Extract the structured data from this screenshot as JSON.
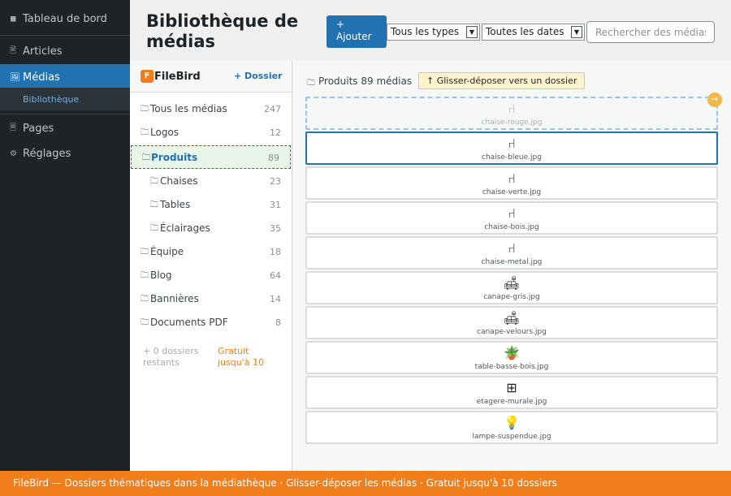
{
  "admin_menu": {
    "items": [
      {
        "label": "Tableau de bord",
        "icon": "dashboard-icon",
        "glyph": "◼"
      },
      {
        "label": "Articles",
        "icon": "posts-icon",
        "glyph": "🖹"
      },
      {
        "label": "Médias",
        "icon": "media-icon",
        "glyph": "🖼",
        "current": true
      },
      {
        "label": "Pages",
        "icon": "pages-icon",
        "glyph": "🗏"
      },
      {
        "label": "Réglages",
        "icon": "settings-icon",
        "glyph": "⚙"
      }
    ],
    "submenu": {
      "label": "Bibliothèque"
    }
  },
  "header": {
    "title": "Bibliothèque de médias",
    "add_button": "+ Ajouter",
    "type_filter": "Tous les types",
    "date_filter": "Toutes les dates",
    "search_placeholder": "Rechercher des médias"
  },
  "filebird": {
    "logo": "F",
    "name": "FileBird",
    "new_folder": "+ Dossier",
    "folder_glyph": "🗀",
    "folders": [
      {
        "label": "Tous les médias",
        "count": "247"
      },
      {
        "label": "Logos",
        "count": "12"
      },
      {
        "label": "Produits",
        "count": "89",
        "active": true
      },
      {
        "label": "Chaises",
        "count": "23",
        "child": true
      },
      {
        "label": "Tables",
        "count": "31",
        "child": true
      },
      {
        "label": "Éclairages",
        "count": "35",
        "child": true
      },
      {
        "label": "Équipe",
        "count": "18"
      },
      {
        "label": "Blog",
        "count": "64"
      },
      {
        "label": "Bannières",
        "count": "14"
      },
      {
        "label": "Documents PDF",
        "count": "8"
      }
    ],
    "footer_left": "+ 0 dossiers restants",
    "footer_right": "Gratuit jusqu'à 10"
  },
  "media": {
    "breadcrumb": "Produits 89 médias",
    "drag_hint": "↑ Glisser-déposer vers un dossier",
    "drag_handle_glyph": "→",
    "items": [
      {
        "name": "chaise-rouge.jpg",
        "icon": "chair-icon",
        "glyph": "⑁",
        "state": "dragging"
      },
      {
        "name": "chaise-bleue.jpg",
        "icon": "chair-icon",
        "glyph": "⑁",
        "state": "selected"
      },
      {
        "name": "chaise-verte.jpg",
        "icon": "chair-icon",
        "glyph": "⑁"
      },
      {
        "name": "chaise-bois.jpg",
        "icon": "chair-icon",
        "glyph": "⑁"
      },
      {
        "name": "chaise-metal.jpg",
        "icon": "chair-icon",
        "glyph": "⑁"
      },
      {
        "name": "canape-gris.jpg",
        "icon": "sofa-icon",
        "glyph": "🛋"
      },
      {
        "name": "canape-velours.jpg",
        "icon": "sofa-icon",
        "glyph": "🛋"
      },
      {
        "name": "table-basse-bois.jpg",
        "icon": "plant-table-icon",
        "glyph": "🪴"
      },
      {
        "name": "etagere-murale.jpg",
        "icon": "shelf-icon",
        "glyph": "⊞"
      },
      {
        "name": "lampe-suspendue.jpg",
        "icon": "lamp-icon",
        "glyph": "💡"
      }
    ]
  },
  "promo": "FileBird — Dossiers thématiques dans la médiathèque · Glisser-déposer les médias · Gratuit jusqu'à 10 dossiers",
  "colors": {
    "admin_bar": "#1d2327",
    "accent": "#2271b1",
    "filebird": "#f07e1b"
  }
}
